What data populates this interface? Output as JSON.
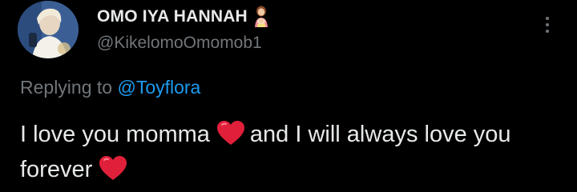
{
  "tweet": {
    "author": {
      "display_name": "OMO IYA HANNAH",
      "handle": "@KikelomoOmomob1",
      "avatar_icon": "avatar-photo",
      "name_emoji_icon": "woman-with-baby-emoji"
    },
    "reply": {
      "prefix": "Replying to",
      "mention": "@Toyflora"
    },
    "text": {
      "part1": "I love you momma",
      "part2": "and I will always love you forever",
      "heart_icon": "red-heart-emoji"
    },
    "more_icon": "more-vertical-icon"
  },
  "colors": {
    "background": "#000000",
    "text_primary": "#e7e9ea",
    "text_secondary": "#71767b",
    "link": "#1d9bf0",
    "heart": "#e0203a"
  }
}
